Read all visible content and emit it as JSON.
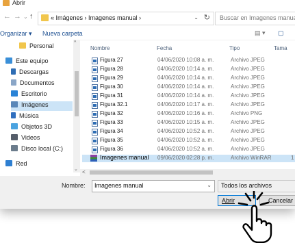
{
  "window": {
    "title": "Abrir"
  },
  "address": {
    "back": "←",
    "forward": "→",
    "recent": "⌄",
    "up": "↑",
    "breadcrumb": "« Imágenes › Imagenes manual ›",
    "dropdown": "⌄",
    "refresh": "↻",
    "search_placeholder": "Buscar en Imagenes manual"
  },
  "toolbar": {
    "organize": "Organizar ▾",
    "new_folder": "Nueva carpeta",
    "view_icon": "▤ ▾",
    "pane_icon": "▢"
  },
  "sidebar": {
    "items": [
      {
        "label": "Personal",
        "icon": "folder-icon",
        "color": "#f1c64c"
      },
      {
        "label": "Este equipo",
        "icon": "computer-icon",
        "color": "#3a8fd8"
      },
      {
        "label": "Descargas",
        "icon": "download-icon",
        "color": "#2e6db4"
      },
      {
        "label": "Documentos",
        "icon": "documents-icon",
        "color": "#8aa6c7"
      },
      {
        "label": "Escritorio",
        "icon": "desktop-icon",
        "color": "#2a83d6"
      },
      {
        "label": "Imágenes",
        "icon": "pictures-icon",
        "color": "#5a87b8"
      },
      {
        "label": "Música",
        "icon": "music-icon",
        "color": "#2f6fbf"
      },
      {
        "label": "Objetos 3D",
        "icon": "cube-icon",
        "color": "#4aa3e0"
      },
      {
        "label": "Videos",
        "icon": "video-icon",
        "color": "#555e6a"
      },
      {
        "label": "Disco local (C:)",
        "icon": "drive-icon",
        "color": "#6b7c8c"
      },
      {
        "label": "Red",
        "icon": "network-icon",
        "color": "#2e7fd1"
      }
    ],
    "scroll_up": "^",
    "scroll_down": "⌄"
  },
  "columns": {
    "name": "Nombre",
    "date": "Fecha",
    "type": "Tipo",
    "size": "Tama"
  },
  "files": [
    {
      "name": "Figura 27",
      "date": "04/06/2020 10:08 a. m.",
      "type": "Archivo JPEG",
      "size": ""
    },
    {
      "name": "Figura 28",
      "date": "04/06/2020 10:14 a. m.",
      "type": "Archivo JPEG",
      "size": ""
    },
    {
      "name": "Figura 29",
      "date": "04/06/2020 10:14 a. m.",
      "type": "Archivo JPEG",
      "size": ""
    },
    {
      "name": "Figura 30",
      "date": "04/06/2020 10:14 a. m.",
      "type": "Archivo JPEG",
      "size": ""
    },
    {
      "name": "Figura 31",
      "date": "04/06/2020 10:14 a. m.",
      "type": "Archivo JPEG",
      "size": ""
    },
    {
      "name": "Figura 32.1",
      "date": "04/06/2020 10:17 a. m.",
      "type": "Archivo JPEG",
      "size": ""
    },
    {
      "name": "Figura 32",
      "date": "04/06/2020 10:16 a. m.",
      "type": "Archivo PNG",
      "size": ""
    },
    {
      "name": "Figura 33",
      "date": "04/06/2020 10:15 a. m.",
      "type": "Archivo JPEG",
      "size": ""
    },
    {
      "name": "Figura 34",
      "date": "04/06/2020 10:52 a. m.",
      "type": "Archivo JPEG",
      "size": ""
    },
    {
      "name": "Figura 35",
      "date": "04/06/2020 10:52 a. m.",
      "type": "Archivo JPEG",
      "size": ""
    },
    {
      "name": "Figura 36",
      "date": "04/06/2020 10:52 a. m.",
      "type": "Archivo JPEG",
      "size": ""
    },
    {
      "name": "Imagenes manual",
      "date": "09/06/2020 02:28 p. m.",
      "type": "Archivo WinRAR",
      "size": "1"
    }
  ],
  "footer": {
    "name_label": "Nombre:",
    "name_value": "Imagenes manual",
    "name_dropdown": "⌄",
    "filter": "Todos los archivos",
    "open": "Abrir",
    "cancel": "Cancelar"
  }
}
